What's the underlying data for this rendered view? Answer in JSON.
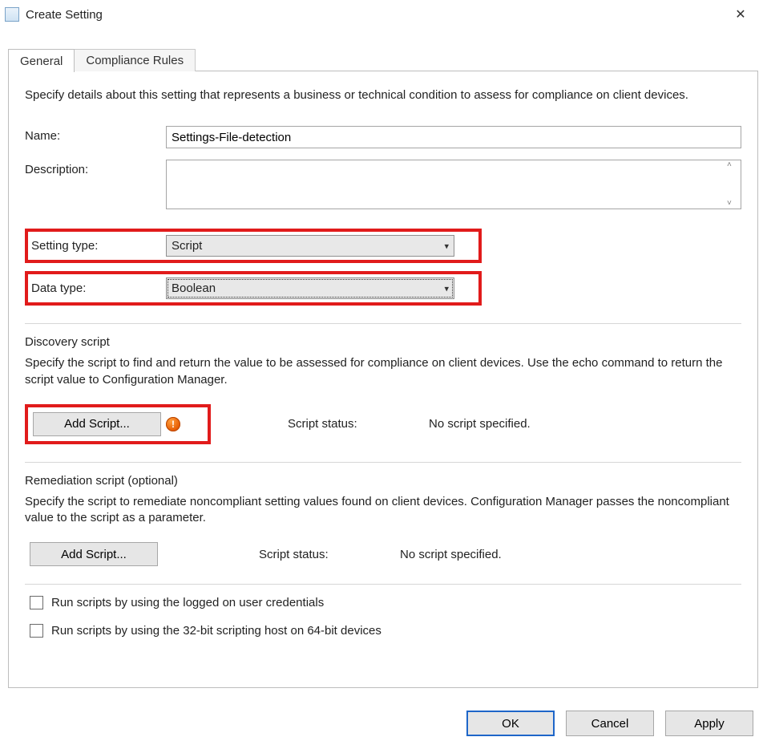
{
  "window": {
    "title": "Create Setting"
  },
  "tabs": {
    "general": "General",
    "compliance": "Compliance Rules"
  },
  "general": {
    "intro": "Specify details about this setting that represents a business or technical condition to assess for compliance on client devices.",
    "name_label": "Name:",
    "name_value": "Settings-File-detection",
    "desc_label": "Description:",
    "desc_value": "",
    "setting_type_label": "Setting type:",
    "setting_type_value": "Script",
    "data_type_label": "Data type:",
    "data_type_value": "Boolean"
  },
  "discovery": {
    "title": "Discovery script",
    "desc": "Specify the script to find and return the value to be assessed for compliance on client devices. Use the echo command to return the script value to Configuration Manager.",
    "add_button": "Add Script...",
    "status_label": "Script status:",
    "status_value": "No script specified."
  },
  "remediation": {
    "title": "Remediation script (optional)",
    "desc": "Specify the script to remediate noncompliant setting values found on client devices. Configuration Manager passes the noncompliant value to the script as a parameter.",
    "add_button": "Add Script...",
    "status_label": "Script status:",
    "status_value": "No script specified."
  },
  "options": {
    "run_as_user": "Run scripts by using the logged on user credentials",
    "run_32bit": "Run scripts by using the 32-bit scripting host on 64-bit devices"
  },
  "footer": {
    "ok": "OK",
    "cancel": "Cancel",
    "apply": "Apply"
  }
}
